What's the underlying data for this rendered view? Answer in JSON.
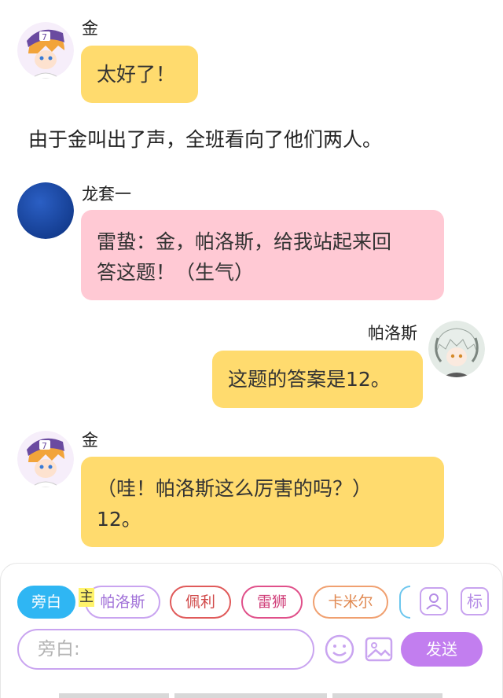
{
  "messages": [
    {
      "sender": "金",
      "text": "太好了！"
    },
    {
      "narration": "由于金叫出了声，全班看向了他们两人。"
    },
    {
      "sender": "龙套一",
      "text_line1": "雷蛰：金，帕洛斯，给我站起来回",
      "text_line2": "答这题！（生气）"
    },
    {
      "sender": "帕洛斯",
      "text": "这题的答案是12。"
    },
    {
      "sender": "金",
      "text_line1": "（哇！帕洛斯这么厉害的吗？）",
      "text_line2": "12。"
    }
  ],
  "role_bar": {
    "selected": "旁白",
    "marker": "主",
    "chips": [
      {
        "label": "帕洛斯",
        "color": "#c9a4f0"
      },
      {
        "label": "佩利",
        "color": "#e05a5a"
      },
      {
        "label": "雷狮",
        "color": "#e0508a"
      },
      {
        "label": "卡米尔",
        "color": "#f0a070"
      }
    ],
    "person_button_icon": "person-card-icon",
    "tag_button_label": "标"
  },
  "composer": {
    "placeholder": "旁白:",
    "emoji_icon": "smiley-icon",
    "image_icon": "image-icon",
    "send_label": "发送"
  },
  "colors": {
    "bubble_yellow": "#ffdb6e",
    "bubble_pink": "#ffc9d4",
    "accent_purple": "#c27eef",
    "active_chip": "#2fb6f3"
  }
}
